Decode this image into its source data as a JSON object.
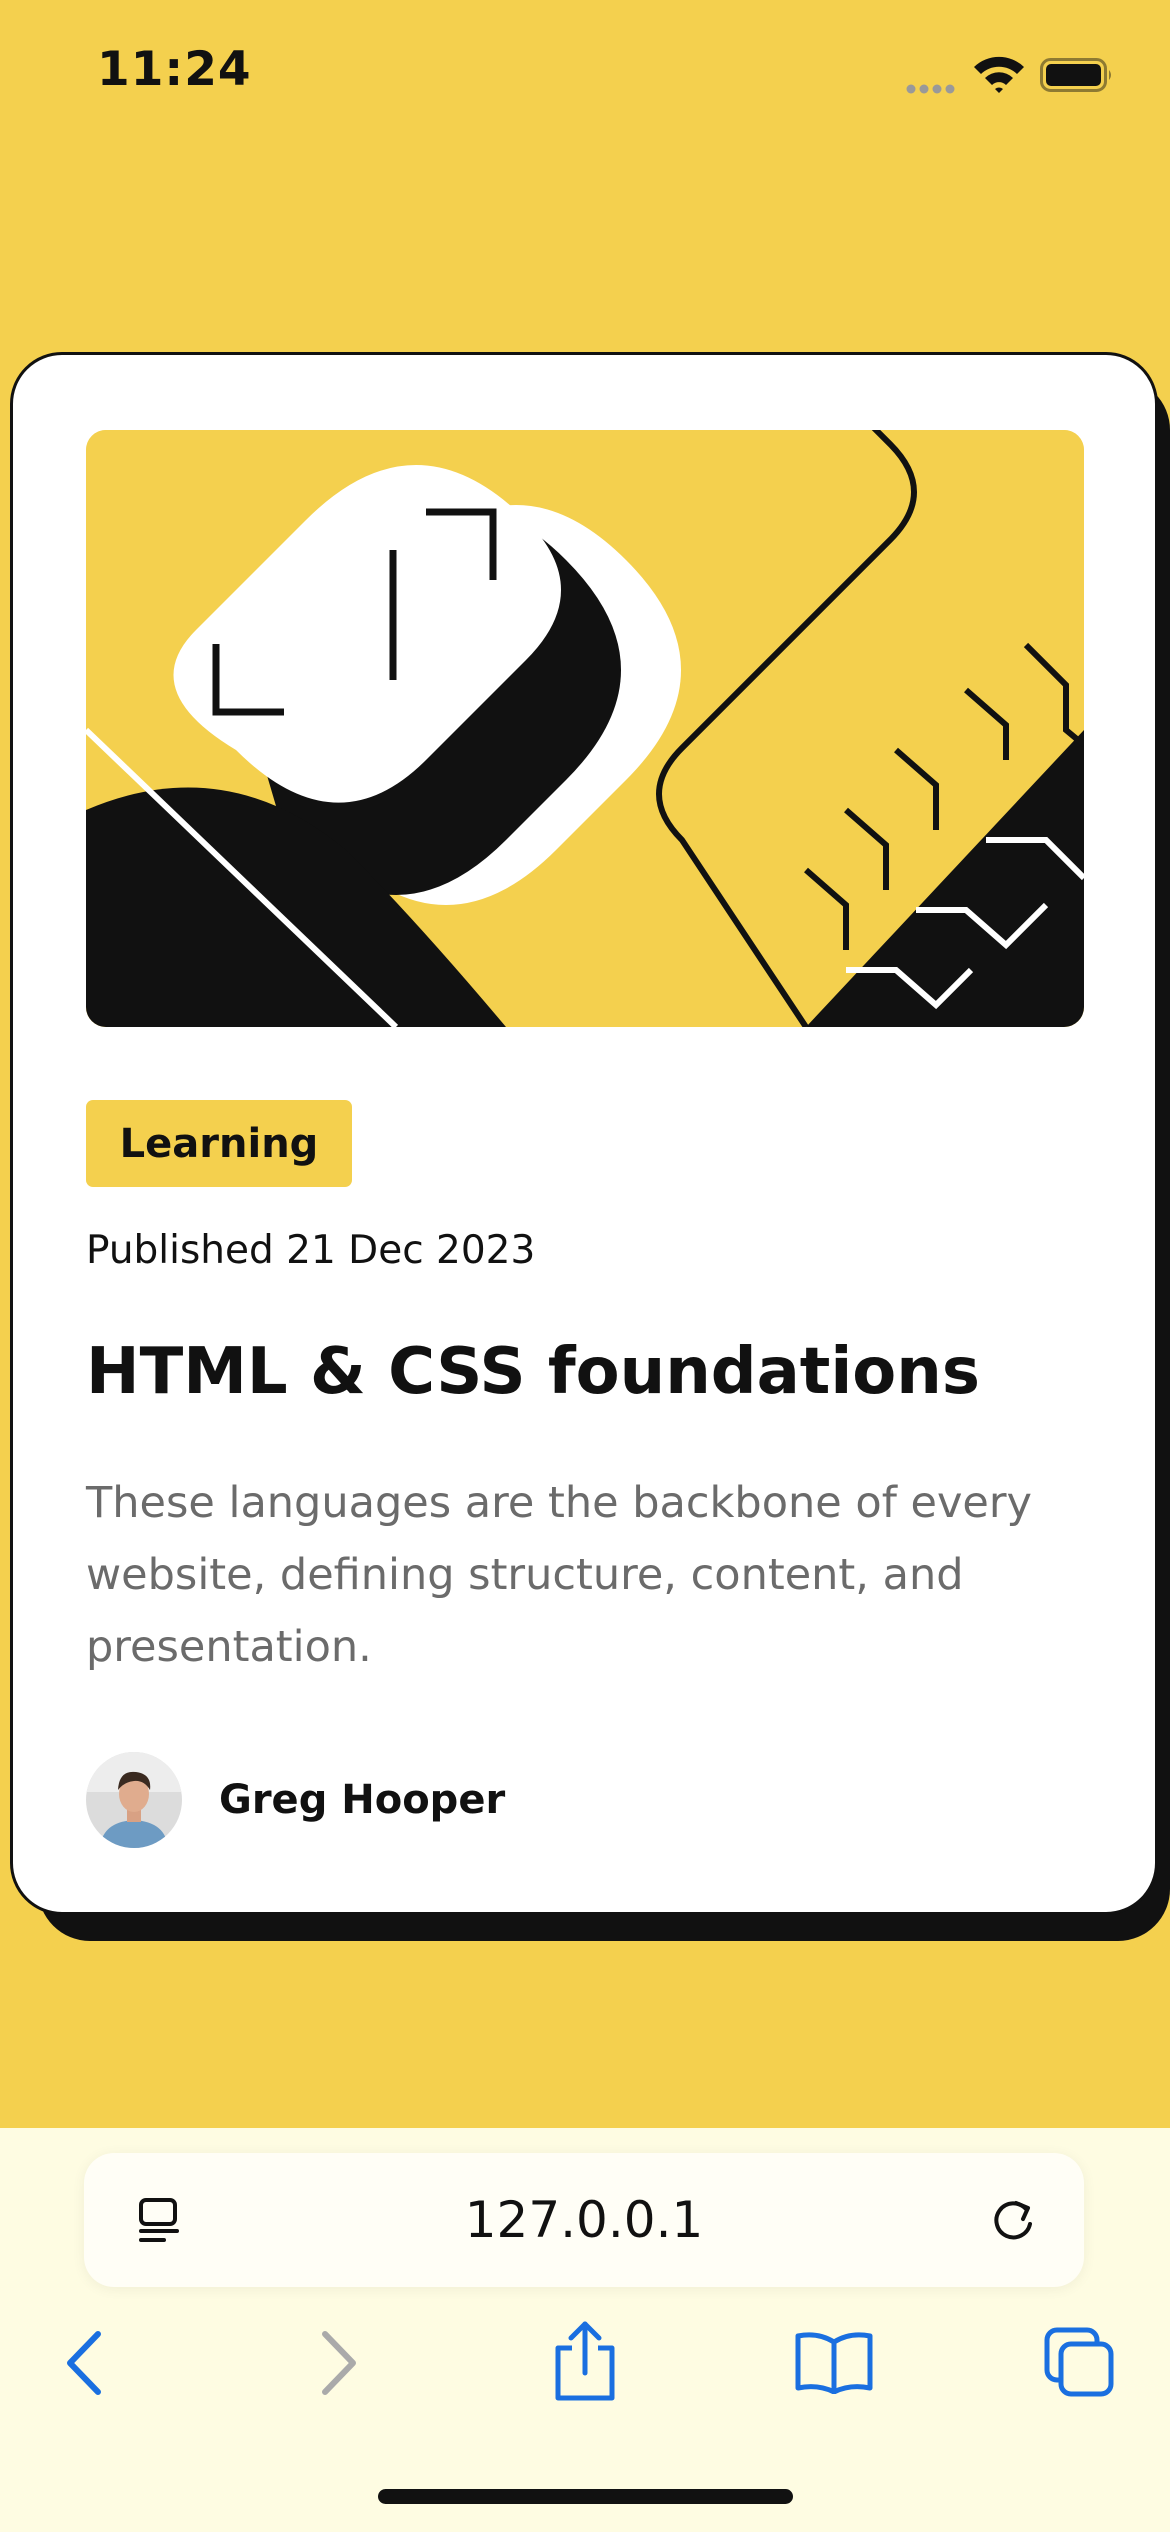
{
  "status_bar": {
    "time": "11:24",
    "icons": [
      "cellular-signal-icon",
      "wifi-icon",
      "battery-icon"
    ]
  },
  "card": {
    "illustration_name": "abstract-geometric-illustration",
    "category": "Learning",
    "published": "Published 21 Dec 2023",
    "title": "HTML & CSS foundations",
    "description": "These languages are the backbone of every website, defining structure, content, and presentation.",
    "author": {
      "name": "Greg Hooper",
      "avatar_icon": "author-avatar"
    }
  },
  "browser": {
    "url": "127.0.0.1",
    "toolbar_icons": [
      "chevron-left-icon",
      "chevron-right-icon",
      "share-icon",
      "book-icon",
      "tabs-icon"
    ]
  },
  "colors": {
    "page_background": "#F4D04E",
    "card_background": "#FFFFFF",
    "ink": "#111111",
    "muted_text": "#6B6B6B",
    "accent": "#F4D04E",
    "browser_link": "#1A6FE0",
    "browser_disabled": "#AAAAAA",
    "chrome_background": "#FEFCE2"
  }
}
